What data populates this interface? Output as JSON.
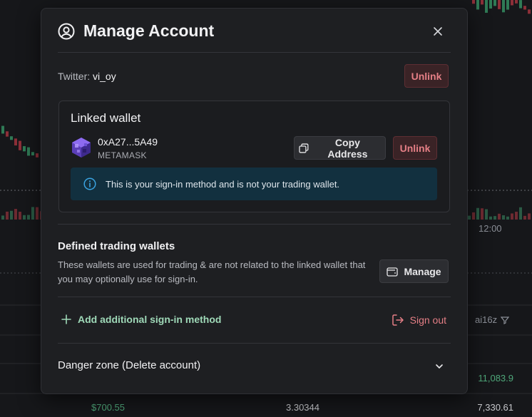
{
  "background": {
    "time_label": "12:00",
    "filter_label": "ai16z",
    "value_top": "11,083.9",
    "row_price": "$700.55",
    "row_mid": "3.30344",
    "row_right": "7,330.61"
  },
  "modal": {
    "title": "Manage Account",
    "twitter": {
      "prefix": "Twitter:",
      "handle": "vi_oy",
      "unlink_label": "Unlink"
    },
    "linked_wallet": {
      "title": "Linked wallet",
      "address": "0xA27...5A49",
      "provider": "METAMASK",
      "copy_label": "Copy Address",
      "unlink_label": "Unlink",
      "info_text": "This is your sign-in method and is not your trading wallet."
    },
    "trading_wallets": {
      "title": "Defined trading wallets",
      "description": "These wallets are used for trading & are not related to the linked wallet that you may optionally use for sign-in.",
      "manage_label": "Manage"
    },
    "add_method_label": "Add additional sign-in method",
    "sign_out_label": "Sign out",
    "danger_zone_label": "Danger zone (Delete account)"
  },
  "colors": {
    "accent_green": "#9fd9b8",
    "danger_red": "#e57f86",
    "info_bg": "#12303f",
    "info_icon": "#3aa3e0"
  },
  "icons": [
    "user-circle-icon",
    "close-icon",
    "wallet-avatar-icon",
    "copy-icon",
    "info-icon",
    "wallet-icon",
    "plus-icon",
    "sign-out-icon",
    "chevron-down-icon",
    "filter-icon"
  ]
}
